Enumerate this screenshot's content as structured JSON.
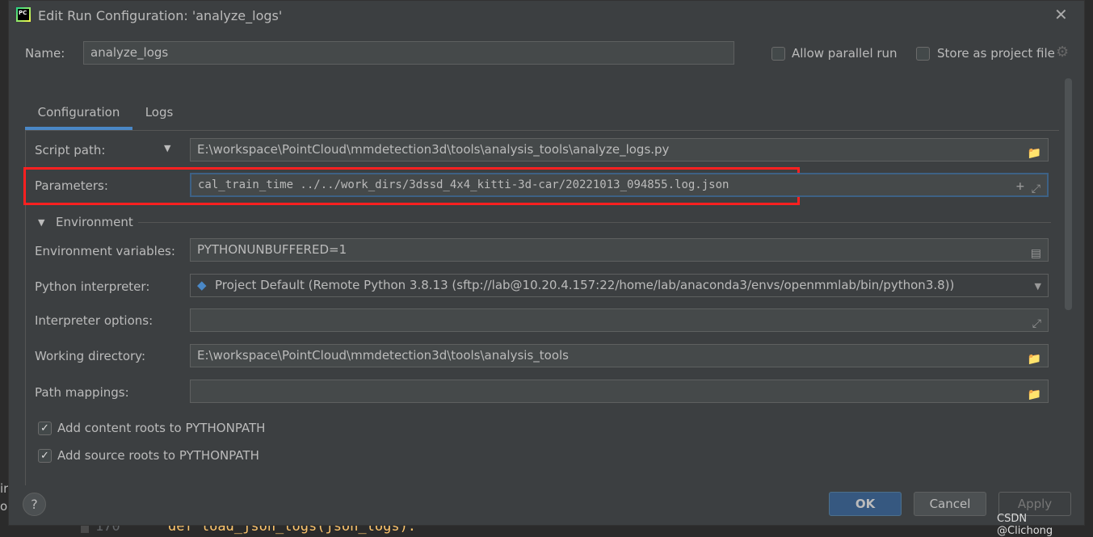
{
  "window": {
    "title": "Edit Run Configuration: 'analyze_logs'",
    "app_icon": "pycharm-icon",
    "close_icon": "close-icon"
  },
  "name": {
    "label": "Name:",
    "value": "analyze_logs"
  },
  "options": {
    "allow_parallel": "Allow parallel run",
    "allow_parallel_checked": false,
    "store_project": "Store as project file",
    "store_project_checked": false
  },
  "tabs": [
    {
      "label": "Configuration",
      "active": true
    },
    {
      "label": "Logs",
      "active": false
    }
  ],
  "form": {
    "script_path": {
      "label": "Script path:",
      "value": "E:\\workspace\\PointCloud\\mmdetection3d\\tools\\analysis_tools\\analyze_logs.py"
    },
    "parameters": {
      "label": "Parameters:",
      "value": "cal_train_time ../../work_dirs/3dssd_4x4_kitti-3d-car/20221013_094855.log.json"
    },
    "environment_section": "Environment",
    "env_vars": {
      "label": "Environment variables:",
      "value": "PYTHONUNBUFFERED=1"
    },
    "interpreter": {
      "label": "Python interpreter:",
      "value": "Project Default (Remote Python 3.8.13 (sftp://lab@10.20.4.157:22/home/lab/anaconda3/envs/openmmlab/bin/python3.8))"
    },
    "interpreter_options": {
      "label": "Interpreter options:",
      "value": ""
    },
    "working_dir": {
      "label": "Working directory:",
      "value": "E:\\workspace\\PointCloud\\mmdetection3d\\tools\\analysis_tools"
    },
    "path_mappings": {
      "label": "Path mappings:",
      "value": ""
    },
    "content_roots": {
      "label": "Add content roots to PYTHONPATH",
      "checked": true
    },
    "source_roots": {
      "label": "Add source roots to PYTHONPATH",
      "checked": true
    }
  },
  "buttons": {
    "ok": "OK",
    "cancel": "Cancel",
    "apply": "Apply",
    "help": "?"
  },
  "background_code": {
    "line_number": "170",
    "code": "def load_json_logs(json_logs):",
    "left_fragments": [
      "ir",
      "oi"
    ]
  },
  "watermark": "CSDN @Clichong",
  "colors": {
    "accent": "#4a88c7",
    "highlight": "#ff2020",
    "ok_button": "#365880"
  }
}
